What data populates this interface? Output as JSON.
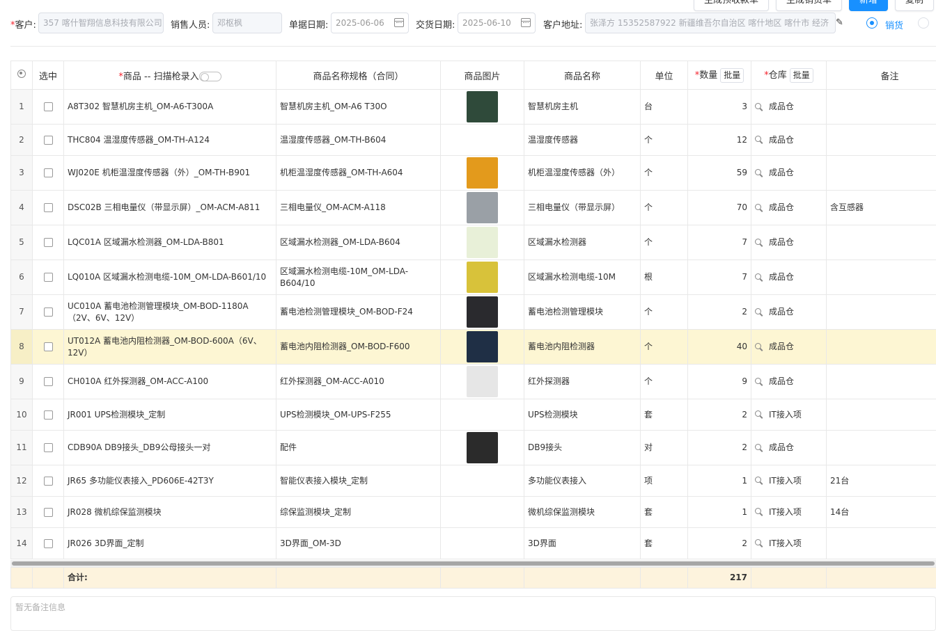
{
  "toolbar": {
    "buttons": [
      "生成预收款单",
      "生成销货单",
      "新增",
      "复制"
    ]
  },
  "form": {
    "customer_label": "客户:",
    "customer_value": "357 喀什智翔信息科技有限公司",
    "sales_label": "销售人员:",
    "sales_value": "邓枢枫",
    "doc_date_label": "单据日期:",
    "doc_date_value": "2025-06-06",
    "delivery_date_label": "交货日期:",
    "delivery_date_value": "2025-06-10",
    "address_label": "客户地址:",
    "address_value": "张泽方 15352587922 新疆维吾尔自治区 喀什地区 喀什市 经济",
    "radio_sales_label": "销货"
  },
  "table": {
    "headers": {
      "select": "选中",
      "product": "商品 -- 扫描枪录入",
      "spec": "商品名称规格（合同）",
      "image": "商品图片",
      "name": "商品名称",
      "unit": "单位",
      "qty": "数量",
      "warehouse": "仓库",
      "remark": "备注",
      "batch": "批量"
    },
    "rows": [
      {
        "idx": "1",
        "product": "A8T302 智慧机房主机_OM-A6-T300A",
        "spec": "智慧机房主机_OM-A6 T30O",
        "has_img": true,
        "img_color": "#2f4a3a",
        "name": "智慧机房主机",
        "unit": "台",
        "qty": "3",
        "warehouse": "成品仓",
        "remark": ""
      },
      {
        "idx": "2",
        "product": "THC804 温湿度传感器_OM-TH-A124",
        "spec": "温湿度传感器_OM-TH-B604",
        "has_img": false,
        "img_color": "",
        "name": "温湿度传感器",
        "unit": "个",
        "qty": "12",
        "warehouse": "成品仓",
        "remark": ""
      },
      {
        "idx": "3",
        "product": "WJ020E 机柜温湿度传感器（外）_OM-TH-B901",
        "spec": "机柜温湿度传感器_OM-TH-A604",
        "has_img": true,
        "img_color": "#e39a1c",
        "name": "机柜温湿度传感器（外）",
        "unit": "个",
        "qty": "59",
        "warehouse": "成品仓",
        "remark": ""
      },
      {
        "idx": "4",
        "product": "DSC02B 三相电量仪（带显示屏）_OM-ACM-A811",
        "spec": "三相电量仪_OM-ACM-A118",
        "has_img": true,
        "img_color": "#9aa0a6",
        "name": "三相电量仪（带显示屏）",
        "unit": "个",
        "qty": "70",
        "warehouse": "成品仓",
        "remark": "含互感器"
      },
      {
        "idx": "5",
        "product": "LQC01A 区域漏水检测器_OM-LDA-B801",
        "spec": "区域漏水检测器_OM-LDA-B604",
        "has_img": true,
        "img_color": "#e8f0d8",
        "name": "区域漏水检测器",
        "unit": "个",
        "qty": "7",
        "warehouse": "成品仓",
        "remark": ""
      },
      {
        "idx": "6",
        "product": "LQ010A 区域漏水检测电缆-10M_OM-LDA-B601/10",
        "spec": "区域漏水检测电缆-10M_OM-LDA-B604/10",
        "has_img": true,
        "img_color": "#d8c23a",
        "name": "区域漏水检测电缆-10M",
        "unit": "根",
        "qty": "7",
        "warehouse": "成品仓",
        "remark": ""
      },
      {
        "idx": "7",
        "product": "UC010A 蓄电池检测管理模块_OM-BOD-1180A（2V、6V、12V）",
        "spec": "蓄电池检测管理模块_OM-BOD-F24",
        "has_img": true,
        "img_color": "#2a2a2e",
        "name": "蓄电池检测管理模块",
        "unit": "个",
        "qty": "2",
        "warehouse": "成品仓",
        "remark": ""
      },
      {
        "idx": "8",
        "product": "UT012A 蓄电池内阻检测器_OM-BOD-600A（6V、12V）",
        "spec": "蓄电池内阻检测器_OM-BOD-F600",
        "has_img": true,
        "img_color": "#1f2f45",
        "name": "蓄电池内阻检测器",
        "unit": "个",
        "qty": "40",
        "warehouse": "成品仓",
        "remark": "",
        "selected": true
      },
      {
        "idx": "9",
        "product": "CH010A 红外探测器_OM-ACC-A100",
        "spec": "红外探测器_OM-ACC-A010",
        "has_img": true,
        "img_color": "#e6e6e6",
        "name": "红外探测器",
        "unit": "个",
        "qty": "9",
        "warehouse": "成品仓",
        "remark": ""
      },
      {
        "idx": "10",
        "product": "JR001 UPS检测模块_定制",
        "spec": "UPS检测模块_OM-UPS-F255",
        "has_img": false,
        "img_color": "",
        "name": "UPS检测模块",
        "unit": "套",
        "qty": "2",
        "warehouse": "IT接入项",
        "remark": ""
      },
      {
        "idx": "11",
        "product": "CDB90A DB9接头_DB9公母接头一对",
        "spec": "配件",
        "has_img": true,
        "img_color": "#2b2b2b",
        "name": "DB9接头",
        "unit": "对",
        "qty": "2",
        "warehouse": "成品仓",
        "remark": ""
      },
      {
        "idx": "12",
        "product": "JR65 多功能仪表接入_PD606E-42T3Y",
        "spec": "智能仪表接入模块_定制",
        "has_img": false,
        "img_color": "",
        "name": "多功能仪表接入",
        "unit": "项",
        "qty": "1",
        "warehouse": "IT接入项",
        "remark": "21台"
      },
      {
        "idx": "13",
        "product": "JR028 微机综保监测模块",
        "spec": "综保监测模块_定制",
        "has_img": false,
        "img_color": "",
        "name": "微机综保监测模块",
        "unit": "套",
        "qty": "1",
        "warehouse": "IT接入项",
        "remark": "14台"
      },
      {
        "idx": "14",
        "product": "JR026 3D界面_定制",
        "spec": "3D界面_OM-3D",
        "has_img": false,
        "img_color": "",
        "name": "3D界面",
        "unit": "套",
        "qty": "2",
        "warehouse": "IT接入项",
        "remark": ""
      }
    ],
    "totals": {
      "label": "合计:",
      "qty": "217"
    }
  },
  "remark_placeholder": "暂无备注信息"
}
